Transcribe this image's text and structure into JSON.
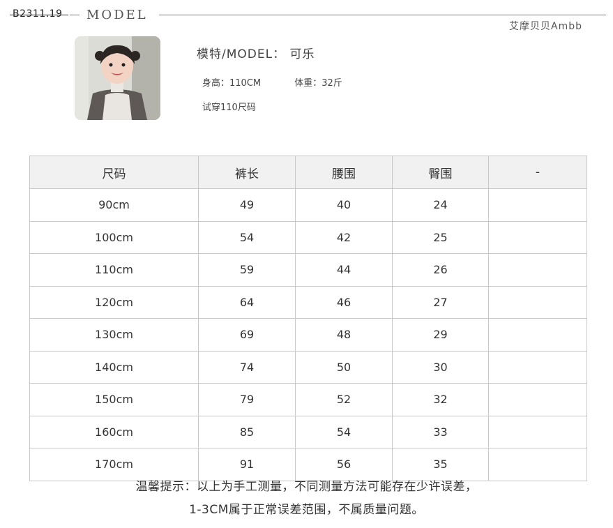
{
  "header": {
    "product_code": "B2311.19",
    "section_title": "MODEL",
    "brand": "艾摩贝贝Ambb"
  },
  "model": {
    "name_label": "模特/MODEL： 可乐",
    "height": "身高：110CM",
    "weight": "体重：32斤",
    "trial_size": "试穿110尺码"
  },
  "size_table": {
    "headers": [
      "尺码",
      "裤长",
      "腰围",
      "臀围",
      "-"
    ],
    "rows": [
      [
        "90cm",
        "49",
        "40",
        "24",
        ""
      ],
      [
        "100cm",
        "54",
        "42",
        "25",
        ""
      ],
      [
        "110cm",
        "59",
        "44",
        "26",
        ""
      ],
      [
        "120cm",
        "64",
        "46",
        "27",
        ""
      ],
      [
        "130cm",
        "69",
        "48",
        "29",
        ""
      ],
      [
        "140cm",
        "74",
        "50",
        "30",
        ""
      ],
      [
        "150cm",
        "79",
        "52",
        "32",
        ""
      ],
      [
        "160cm",
        "85",
        "54",
        "33",
        ""
      ],
      [
        "170cm",
        "91",
        "56",
        "35",
        ""
      ]
    ]
  },
  "notes": {
    "line1": "温馨提示：以上为手工测量，不同测量方法可能存在少许误差，",
    "line2": "1-3CM属于正常误差范围，不属质量问题。"
  }
}
